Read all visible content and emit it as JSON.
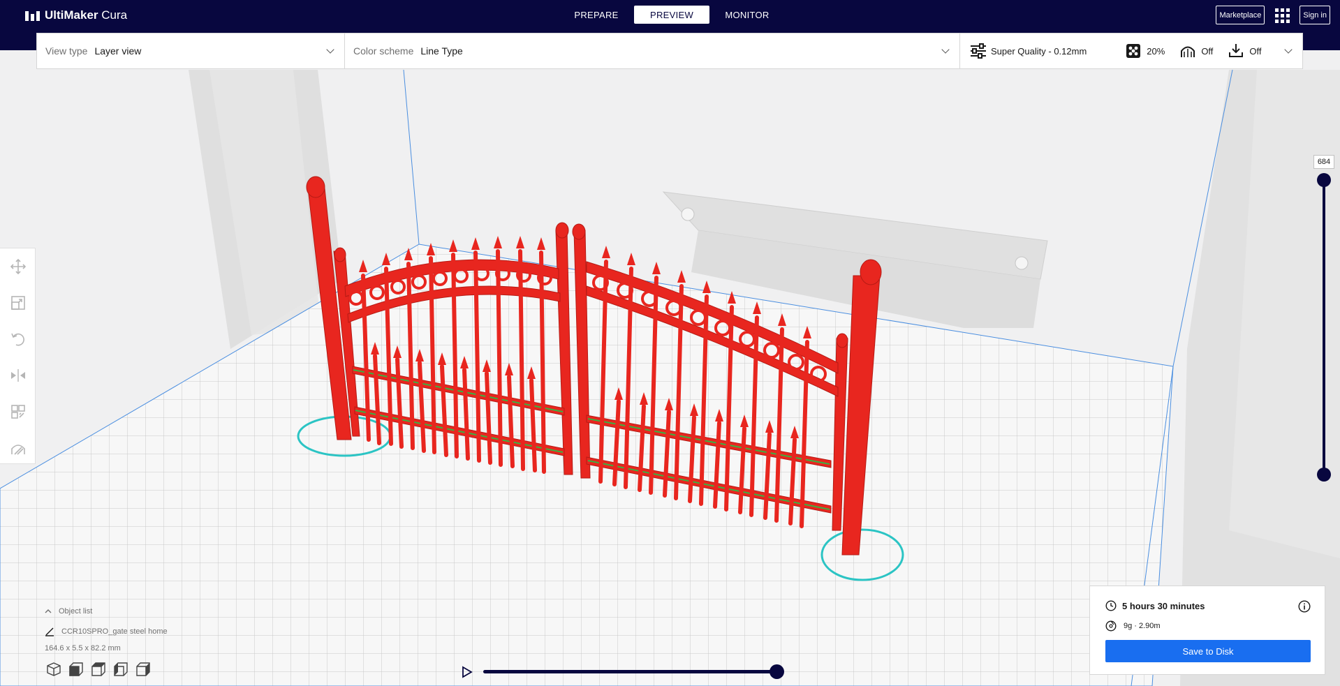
{
  "app": {
    "logo_bold": "UltiMaker",
    "logo_rest": " Cura"
  },
  "header": {
    "tabs": [
      {
        "label": "PREPARE"
      },
      {
        "label": "PREVIEW"
      },
      {
        "label": "MONITOR"
      }
    ],
    "marketplace_label": "Marketplace",
    "signin_label": "Sign in"
  },
  "toolbar": {
    "view_type_label": "View type",
    "view_type_value": "Layer view",
    "color_scheme_label": "Color scheme",
    "color_scheme_value": "Line Type",
    "profile": "Super Quality - 0.12mm",
    "infill": "20%",
    "support": "Off",
    "adhesion": "Off"
  },
  "layer_slider": {
    "current_layer": "684"
  },
  "object_list": {
    "title": "Object list",
    "object_name": "CCR10SPRO_gate steel home",
    "dimensions": "164.6 x 5.5 x 82.2 mm"
  },
  "print_info": {
    "time": "5 hours 30 minutes",
    "material": "9g · 2.90m",
    "save_label": "Save to Disk"
  },
  "colors": {
    "header_bg": "#08073f",
    "accent": "#196ef0",
    "model_red": "#e8261f",
    "skirt_cyan": "#2bc4c4",
    "infill_green": "#3cb043"
  }
}
